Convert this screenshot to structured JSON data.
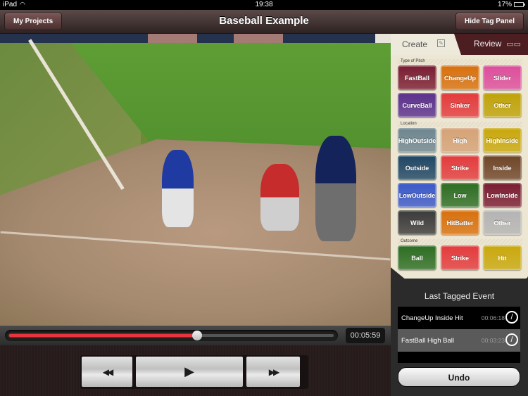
{
  "status_bar": {
    "device": "iPad",
    "time": "19:38",
    "battery": "17%"
  },
  "nav": {
    "left_button": "My Projects",
    "title": "Baseball Example",
    "right_button": "Hide Tag Panel"
  },
  "player": {
    "current_time": "00:05:59",
    "progress_percent": 58
  },
  "controls": {
    "rewind_icon": "◀◀",
    "play_icon": "▶",
    "forward_icon": "▶▶"
  },
  "tabs": {
    "create": "Create",
    "review": "Review",
    "create_icon": "✎",
    "review_icon": "📖"
  },
  "sections": [
    {
      "label": "Type of Pitch",
      "buttons": [
        {
          "label": "FastBall",
          "color": "#7a1c32"
        },
        {
          "label": "ChangeUp",
          "color": "#d8700d"
        },
        {
          "label": "Slider",
          "color": "#dd4d9c"
        },
        {
          "label": "CurveBall",
          "color": "#5a2f8c"
        },
        {
          "label": "Sinker",
          "color": "#e33a3c"
        },
        {
          "label": "Other",
          "color": "#bfa208"
        }
      ]
    },
    {
      "label": "Location",
      "buttons": [
        {
          "label": "HighOutside",
          "color": "#6e8690"
        },
        {
          "label": "High",
          "color": "#d5a276"
        },
        {
          "label": "HighInside",
          "color": "#c9a80c"
        },
        {
          "label": "Outside",
          "color": "#1e4664"
        },
        {
          "label": "Strike",
          "color": "#e33a3c"
        },
        {
          "label": "Inside",
          "color": "#6f4528"
        },
        {
          "label": "LowOutside",
          "color": "#3a58c9"
        },
        {
          "label": "Low",
          "color": "#2c6d22"
        },
        {
          "label": "LowInside",
          "color": "#7a1c32"
        },
        {
          "label": "Wild",
          "color": "#3a3a3a"
        },
        {
          "label": "HitBatter",
          "color": "#d8700d"
        },
        {
          "label": "Other",
          "color": "#b4b4b4"
        }
      ]
    },
    {
      "label": "Outcome",
      "buttons": [
        {
          "label": "Ball",
          "color": "#2c6d22"
        },
        {
          "label": "Strike",
          "color": "#e33a3c"
        },
        {
          "label": "Hit",
          "color": "#c9a80c"
        }
      ]
    }
  ],
  "last_tagged": {
    "title": "Last Tagged Event",
    "events": [
      {
        "name": "ChangeUp Inside Hit",
        "time": "00:06:18"
      },
      {
        "name": "FastBall High Ball",
        "time": "00:03:23"
      }
    ]
  },
  "undo_label": "Undo"
}
